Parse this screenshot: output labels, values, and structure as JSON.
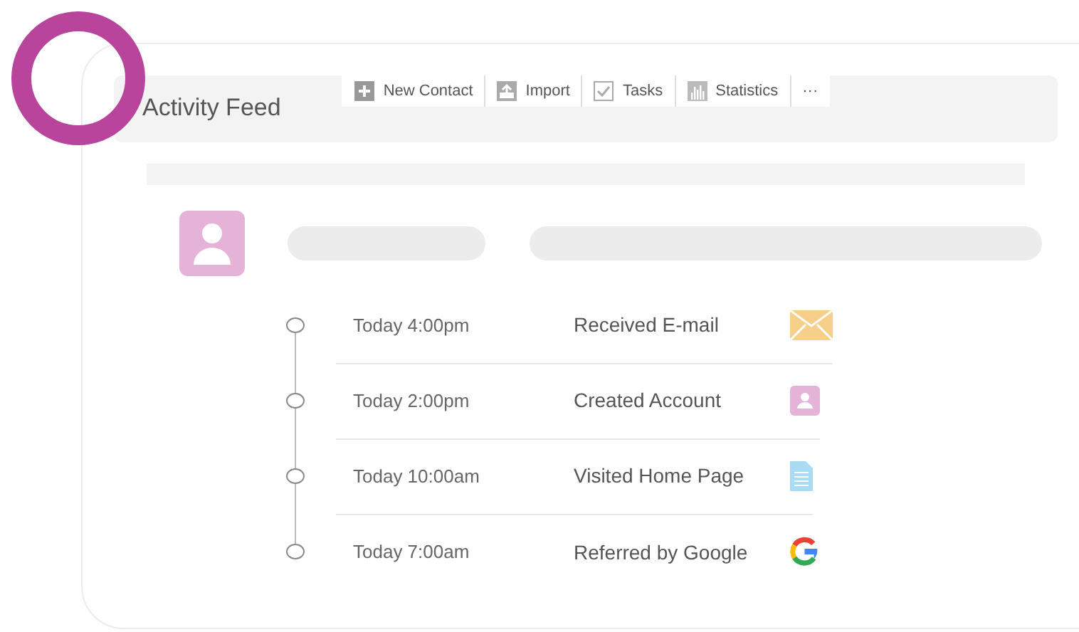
{
  "title": "Activity Feed",
  "toolbar": [
    {
      "label": "New Contact"
    },
    {
      "label": "Import"
    },
    {
      "label": "Tasks"
    },
    {
      "label": "Statistics"
    },
    {
      "label": "···"
    }
  ],
  "events": [
    {
      "time": "Today 4:00pm",
      "label": "Received E-mail"
    },
    {
      "time": "Today 2:00pm",
      "label": "Created Account"
    },
    {
      "time": "Today 10:00am",
      "label": "Visited Home Page"
    },
    {
      "time": "Today 7:00am",
      "label": "Referred by Google"
    }
  ]
}
